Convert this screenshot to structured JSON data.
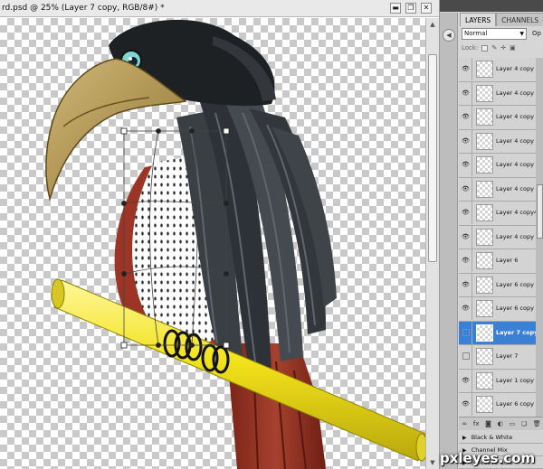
{
  "document": {
    "title": "rd.psd @ 25% (Layer 7 copy, RGB/8#) *",
    "minimize": "▬",
    "restore": "❐",
    "close": "✕"
  },
  "layers_panel": {
    "tabs": [
      {
        "label": "LAYERS",
        "active": true
      },
      {
        "label": "CHANNELS",
        "active": false
      }
    ],
    "blend_mode": "Normal",
    "opacity_label": "Op",
    "lock_label": "Lock:",
    "layers": [
      {
        "name": "Layer 4 copy 20",
        "visible": true,
        "selected": false
      },
      {
        "name": "Layer 4 copy 19",
        "visible": true,
        "selected": false
      },
      {
        "name": "Layer 4 copy 18",
        "visible": true,
        "selected": false
      },
      {
        "name": "Layer 4 copy",
        "visible": true,
        "selected": false
      },
      {
        "name": "Layer 4 copy 2",
        "visible": true,
        "selected": false
      },
      {
        "name": "Layer 4 copy 3",
        "visible": true,
        "selected": false
      },
      {
        "name": "Layer 4 copy4",
        "visible": true,
        "selected": false
      },
      {
        "name": "Layer 4 copy 5",
        "visible": true,
        "selected": false
      },
      {
        "name": "Layer 6",
        "visible": true,
        "selected": false
      },
      {
        "name": "Layer 6 copy",
        "visible": true,
        "selected": false
      },
      {
        "name": "Layer 6 copy 5",
        "visible": true,
        "selected": false
      },
      {
        "name": "Layer 7 copy",
        "visible": false,
        "selected": true
      },
      {
        "name": "Layer 7",
        "visible": false,
        "selected": false
      },
      {
        "name": "Layer 1 copy",
        "visible": true,
        "selected": false
      },
      {
        "name": "Layer 6 copy 2",
        "visible": true,
        "selected": false
      }
    ],
    "bottom_icons": [
      "link-icon",
      "fx-icon",
      "mask-icon",
      "adjustment-icon",
      "folder-icon",
      "new-layer-icon",
      "trash-icon"
    ],
    "adjustment_layers": [
      "Black & White",
      "Channel Mix",
      "Selective Colo"
    ]
  },
  "watermark": "pxleyes.com",
  "colors": {
    "selected_layer": "#3b80d7",
    "panel_bg": "#d6d6d6",
    "perch_yellow": "#f2e21a",
    "bird_black": "#2e3236",
    "beak_tan": "#b89a52",
    "chest_red": "#9c3526"
  }
}
